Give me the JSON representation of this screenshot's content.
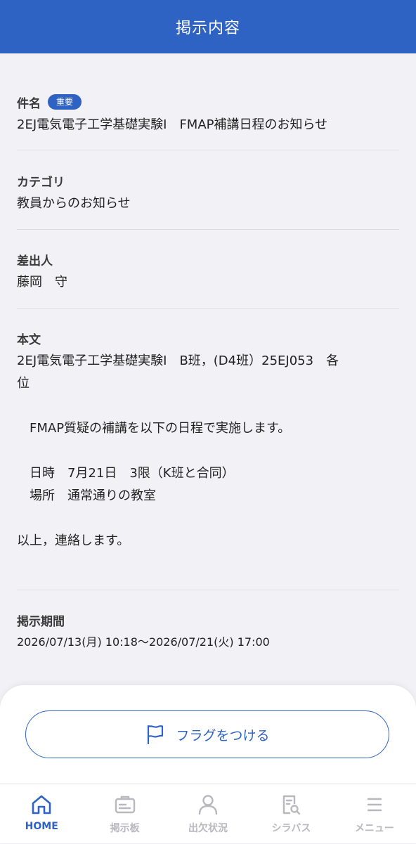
{
  "header": {
    "title": "掲示内容"
  },
  "subject": {
    "label": "件名",
    "badge": "重要",
    "value": "2EJ電気電子工学基礎実験I　FMAP補講日程のお知らせ"
  },
  "category": {
    "label": "カテゴリ",
    "value": "教員からのお知らせ"
  },
  "sender": {
    "label": "差出人",
    "value": "藤岡　守"
  },
  "body": {
    "label": "本文",
    "lines": [
      "2EJ電気電子工学基礎実験I　B班，(D4班）25EJ053　各",
      "位",
      "",
      "　FMAP質疑の補講を以下の日程で実施します。",
      "",
      "　日時　7月21日　3限（K班と合同）",
      "　場所　通常通りの教室",
      "",
      "以上，連絡します。"
    ]
  },
  "period": {
    "label": "掲示期間",
    "value": "2026/07/13(月) 10:18〜2026/07/21(火) 17:00"
  },
  "flag_button": {
    "label": "フラグをつける",
    "icon": "flag-icon"
  },
  "tabs": [
    {
      "label": "HOME",
      "icon": "home-icon",
      "active": true
    },
    {
      "label": "掲示板",
      "icon": "bulletin-board-icon",
      "active": false
    },
    {
      "label": "出欠状況",
      "icon": "person-icon",
      "active": false
    },
    {
      "label": "シラバス",
      "icon": "syllabus-search-icon",
      "active": false
    },
    {
      "label": "メニュー",
      "icon": "menu-icon",
      "active": false
    }
  ],
  "colors": {
    "accent": "#2e63c4",
    "background": "#f2f2f6",
    "inactive_tab": "#b8b8bf"
  }
}
